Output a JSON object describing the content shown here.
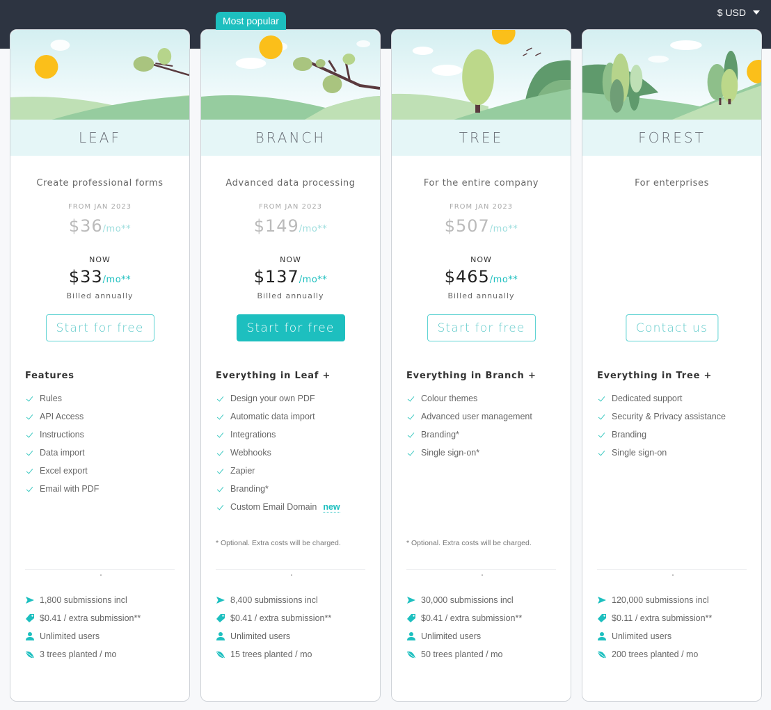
{
  "header": {
    "currency_label": "$ USD",
    "currency_icon": "caret-down-icon"
  },
  "colors": {
    "accent": "#1dbfbf",
    "topbar": "#2d3441",
    "tier_band": "#e5f6f7"
  },
  "plans": [
    {
      "name": "LEAF",
      "badge": null,
      "tagline": "Create professional forms",
      "from_label": "FROM JAN 2023",
      "old_price": "$36",
      "old_per": "/mo**",
      "now_label": "NOW",
      "new_price": "$33",
      "new_per": "/mo**",
      "billing": "Billed annually",
      "cta": "Start for free",
      "cta_primary": false,
      "features_heading": "Features",
      "features": [
        {
          "label": "Rules"
        },
        {
          "label": "API Access"
        },
        {
          "label": "Instructions"
        },
        {
          "label": "Data import"
        },
        {
          "label": "Excel export"
        },
        {
          "label": "Email with PDF"
        }
      ],
      "footnote": "",
      "stats": {
        "submissions": "1,800 submissions incl",
        "extra": "$0.41 / extra submission**",
        "users": "Unlimited users",
        "trees": "3 trees planted / mo"
      }
    },
    {
      "name": "BRANCH",
      "badge": "Most popular",
      "tagline": "Advanced data processing",
      "from_label": "FROM JAN 2023",
      "old_price": "$149",
      "old_per": "/mo**",
      "now_label": "NOW",
      "new_price": "$137",
      "new_per": "/mo**",
      "billing": "Billed annually",
      "cta": "Start for free",
      "cta_primary": true,
      "features_heading": "Everything in Leaf +",
      "features": [
        {
          "label": "Design your own PDF"
        },
        {
          "label": "Automatic data import"
        },
        {
          "label": "Integrations"
        },
        {
          "label": "Webhooks"
        },
        {
          "label": "Zapier"
        },
        {
          "label": "Branding*"
        },
        {
          "label": "Custom Email Domain",
          "badge": "new"
        }
      ],
      "footnote": "* Optional. Extra costs will be charged.",
      "stats": {
        "submissions": "8,400 submissions incl",
        "extra": "$0.41 / extra submission**",
        "users": "Unlimited users",
        "trees": "15 trees planted / mo"
      }
    },
    {
      "name": "TREE",
      "badge": null,
      "tagline": "For the entire company",
      "from_label": "FROM JAN 2023",
      "old_price": "$507",
      "old_per": "/mo**",
      "now_label": "NOW",
      "new_price": "$465",
      "new_per": "/mo**",
      "billing": "Billed annually",
      "cta": "Start for free",
      "cta_primary": false,
      "features_heading": "Everything in Branch +",
      "features": [
        {
          "label": "Colour themes"
        },
        {
          "label": "Advanced user management"
        },
        {
          "label": "Branding*"
        },
        {
          "label": "Single sign-on*"
        }
      ],
      "footnote": "* Optional. Extra costs will be charged.",
      "stats": {
        "submissions": "30,000 submissions incl",
        "extra": "$0.41 / extra submission**",
        "users": "Unlimited users",
        "trees": "50 trees planted / mo"
      }
    },
    {
      "name": "FOREST",
      "badge": null,
      "tagline": "For enterprises",
      "from_label": "",
      "old_price": "",
      "old_per": "",
      "now_label": "",
      "new_price": "",
      "new_per": "",
      "billing": "",
      "cta": "Contact us",
      "cta_primary": false,
      "features_heading": "Everything in Tree +",
      "features": [
        {
          "label": "Dedicated support"
        },
        {
          "label": "Security & Privacy assistance"
        },
        {
          "label": "Branding"
        },
        {
          "label": "Single sign-on"
        }
      ],
      "footnote": "",
      "stats": {
        "submissions": "120,000 submissions incl",
        "extra": "$0.11 / extra submission**",
        "users": "Unlimited users",
        "trees": "200 trees planted / mo"
      }
    }
  ]
}
